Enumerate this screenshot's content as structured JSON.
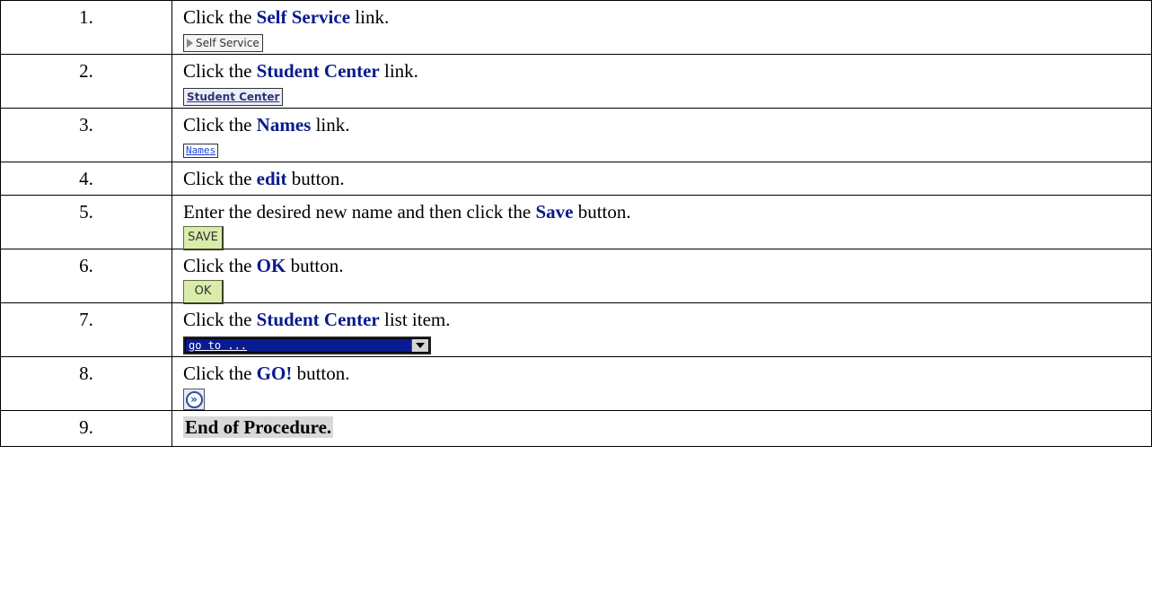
{
  "steps": [
    {
      "num": "1.",
      "pre": "Click the ",
      "kw": "Self Service",
      "post": " link.",
      "widget": {
        "type": "self-service",
        "label": "Self Service"
      }
    },
    {
      "num": "2.",
      "pre": "Click the ",
      "kw": "Student Center",
      "post": " link.",
      "widget": {
        "type": "student-center",
        "label": "Student Center"
      }
    },
    {
      "num": "3.",
      "pre": "Click the ",
      "kw": "Names",
      "post": " link.",
      "widget": {
        "type": "names",
        "label": "Names"
      }
    },
    {
      "num": "4.",
      "pre": "Click the ",
      "kw": "edit",
      "post": " button."
    },
    {
      "num": "5.",
      "pre": "Enter the desired new name and then click the ",
      "kw": "Save",
      "post": " button.",
      "widget": {
        "type": "save",
        "label": "SAVE"
      }
    },
    {
      "num": "6.",
      "pre": "Click the ",
      "kw": "OK",
      "post": " button.",
      "widget": {
        "type": "ok",
        "label": "OK"
      }
    },
    {
      "num": "7.",
      "pre": "Click the ",
      "kw": "Student Center",
      "post": " list item.",
      "widget": {
        "type": "goto",
        "label": "go to ..."
      }
    },
    {
      "num": "8.",
      "pre": "Click the ",
      "kw": "GO!",
      "post": " button.",
      "widget": {
        "type": "go",
        "label": "»"
      }
    },
    {
      "num": "9.",
      "end": "End of Procedure."
    }
  ],
  "colors": {
    "keyword": "#0a1a8c",
    "border": "#000000",
    "save_ok_bg": "#d9ecaa",
    "goto_bg": "#0a1b92"
  }
}
